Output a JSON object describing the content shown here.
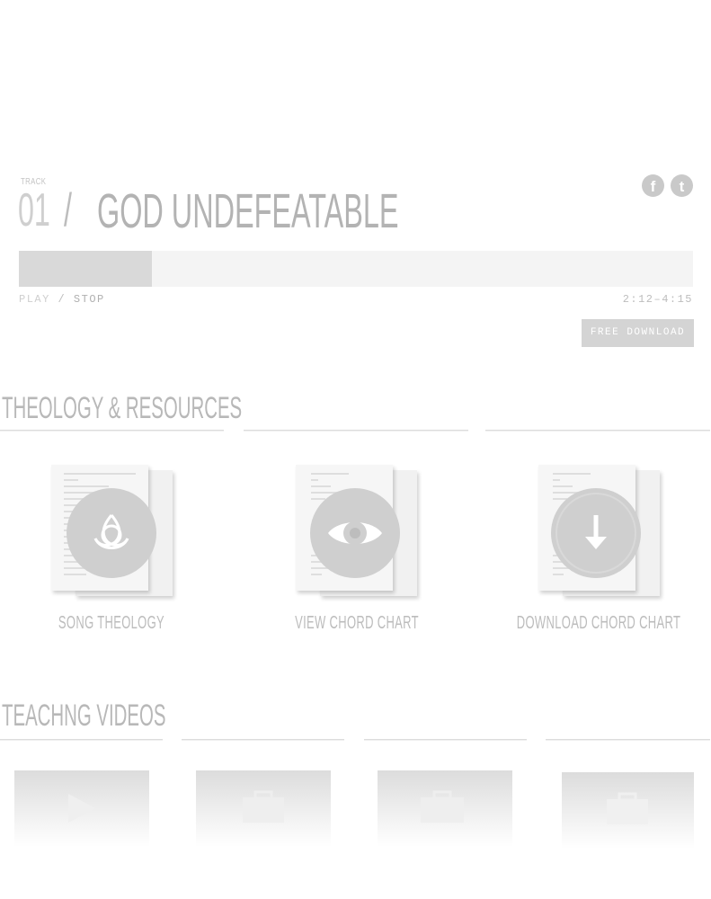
{
  "track": {
    "label": "TRACK",
    "number": "01",
    "separator": "/",
    "title": "GOD UNDEFEATABLE",
    "progress_fraction": 0.197,
    "play_label": "PLAY",
    "stop_label": "STOP",
    "controls_separator": "/",
    "time": "2:12–4:15",
    "download_label": "FREE DOWNLOAD"
  },
  "social": {
    "facebook_glyph": "f",
    "twitter_glyph": "t"
  },
  "theology": {
    "title": "THEOLOGY & RESOURCES",
    "items": [
      {
        "label": "SONG THEOLOGY",
        "icon": "trinity-knot-icon"
      },
      {
        "label": "VIEW CHORD CHART",
        "icon": "eye-icon"
      },
      {
        "label": "DOWNLOAD CHORD CHART",
        "icon": "arrow-down-icon"
      }
    ]
  },
  "videos": {
    "title": "TEACHNG VIDEOS",
    "items": [
      {
        "icon": "play-icon"
      },
      {
        "icon": "briefcase-icon"
      },
      {
        "icon": "briefcase-icon"
      },
      {
        "icon": "briefcase-icon"
      }
    ]
  },
  "colors": {
    "accent_grey": "#cfcfcf",
    "progress_fill": "#d9d9d9",
    "button_bg": "#d4d4d4"
  }
}
